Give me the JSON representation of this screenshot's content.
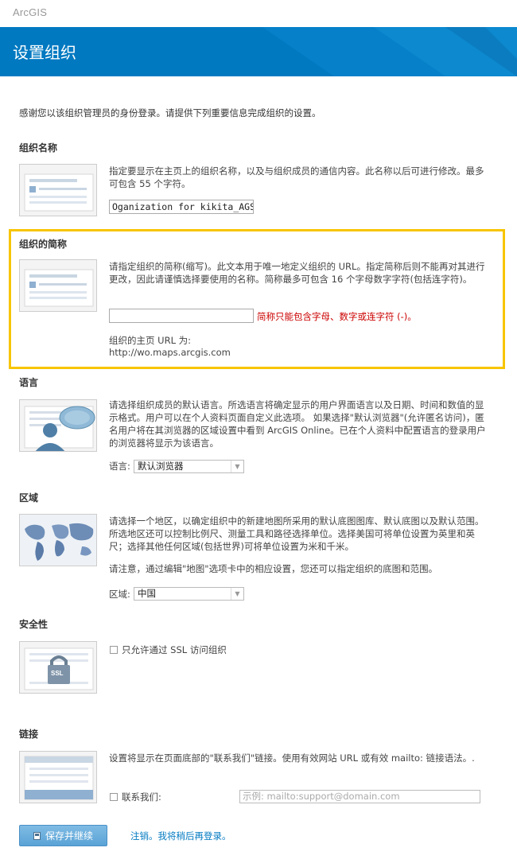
{
  "header": {
    "brand": "ArcGIS",
    "title": "设置组织"
  },
  "intro": "感谢您以该组织管理员的身份登录。请提供下列重要信息完成组织的设置。",
  "org_name": {
    "title": "组织名称",
    "desc": "指定要显示在主页上的组织名称，以及与组织成员的通信内容。此名称以后可进行修改。最多可包含 55 个字符。",
    "value": "Oganization for kikita_AGSOL_"
  },
  "short_name": {
    "title": "组织的简称",
    "desc": "请指定组织的简称(缩写)。此文本用于唯一地定义组织的 URL。指定简称后则不能再对其进行更改，因此请谨慎选择要使用的名称。简称最多可包含 16 个字母数字字符(包括连字符)。",
    "value": "",
    "error": "简称只能包含字母、数字或连字符 (-)。",
    "url_label": "组织的主页 URL 为:",
    "url_value": "http://wo.maps.arcgis.com"
  },
  "language": {
    "title": "语言",
    "desc": "请选择组织成员的默认语言。所选语言将确定显示的用户界面语言以及日期、时间和数值的显示格式。用户可以在个人资料页面自定义此选项。 如果选择\"默认浏览器\"(允许匿名访问)，匿名用户将在其浏览器的区域设置中看到 ArcGIS Online。已在个人资料中配置语言的登录用户的浏览器将显示为该语言。",
    "select_label": "语言:",
    "selected": "默认浏览器"
  },
  "region": {
    "title": "区域",
    "desc": "请选择一个地区，以确定组织中的新建地图所采用的默认底图图库、默认底图以及默认范围。所选地区还可以控制比例尺、测量工具和路径选择单位。选择美国可将单位设置为英里和英尺；选择其他任何区域(包括世界)可将单位设置为米和千米。",
    "note": "请注意，通过编辑\"地图\"选项卡中的相应设置，您还可以指定组织的底图和范围。",
    "select_label": "区域:",
    "selected": "中国"
  },
  "security": {
    "title": "安全性",
    "checkbox_label": "只允许通过 SSL 访问组织",
    "badge": "SSL"
  },
  "links": {
    "title": "链接",
    "desc": "设置将显示在页面底部的\"联系我们\"链接。使用有效网站 URL 或有效 mailto: 链接语法。.",
    "checkbox_label": "联系我们:",
    "placeholder": "示例: mailto:support@domain.com"
  },
  "actions": {
    "save_label": "保存并继续",
    "cancel_label": "注销。我将稍后再登录。"
  },
  "colors": {
    "banner": "#0079c1",
    "highlight": "#f7c500",
    "error": "#cc0000"
  }
}
